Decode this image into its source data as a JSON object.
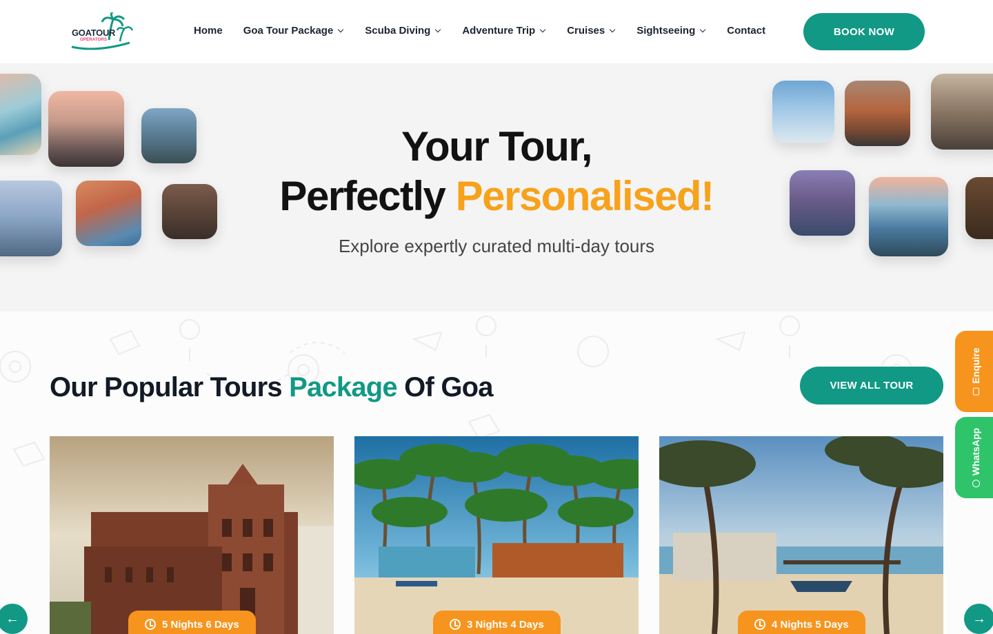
{
  "brand": {
    "name": "GOATOUR",
    "sub": "OPERATORS",
    "teal": "#119985",
    "orange": "#f7941d",
    "yellow": "#f7a21b"
  },
  "nav": {
    "items": [
      {
        "label": "Home",
        "dropdown": false
      },
      {
        "label": "Goa Tour Package",
        "dropdown": true
      },
      {
        "label": "Scuba Diving",
        "dropdown": true
      },
      {
        "label": "Adventure Trip",
        "dropdown": true
      },
      {
        "label": "Cruises",
        "dropdown": true
      },
      {
        "label": "Sightseeing",
        "dropdown": true
      },
      {
        "label": "Contact",
        "dropdown": false
      }
    ],
    "cta": "BOOK NOW"
  },
  "hero": {
    "line1": "Your Tour,",
    "line2_plain": "Perfectly ",
    "line2_accent": "Personalised!",
    "subtitle": "Explore expertly curated multi-day tours"
  },
  "section": {
    "title_part1": "Our Popular Tours ",
    "title_accent": "Package",
    "title_part2": " Of Goa",
    "view_all": "VIEW ALL TOUR"
  },
  "cards": [
    {
      "duration": "5 Nights 6 Days",
      "image": "church-photo"
    },
    {
      "duration": "3 Nights 4 Days",
      "image": "palm-beach-huts-photo"
    },
    {
      "duration": "4 Nights 5 Days",
      "image": "beach-pier-photo"
    }
  ],
  "side_tabs": {
    "enquire": "Enquire",
    "whatsapp": "WhatsApp"
  },
  "carousel": {
    "prev": "←",
    "next": "→"
  }
}
